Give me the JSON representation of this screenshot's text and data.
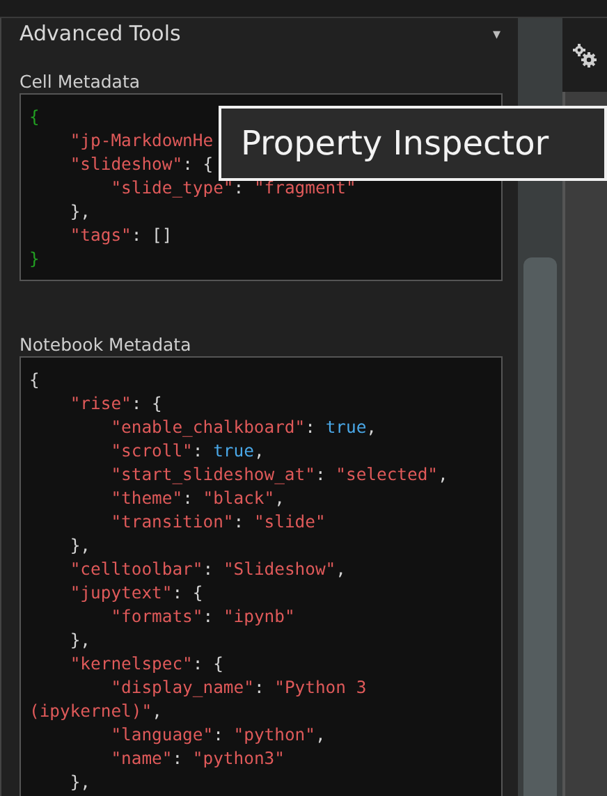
{
  "panel": {
    "title": "Advanced Tools",
    "collapse_icon": "▾"
  },
  "sections": [
    {
      "label": "Cell Metadata",
      "lines": [
        [
          {
            "kind": "brace",
            "text": "{"
          }
        ],
        [
          {
            "kind": "key",
            "text": "    \"jp-MarkdownHe"
          }
        ],
        [
          {
            "kind": "key",
            "text": "    \"slideshow\""
          },
          {
            "kind": "punct",
            "text": ": {"
          }
        ],
        [
          {
            "kind": "key",
            "text": "        \"slide_type\""
          },
          {
            "kind": "punct",
            "text": ": "
          },
          {
            "kind": "str",
            "text": "\"fragment\""
          }
        ],
        [
          {
            "kind": "punct",
            "text": "    },"
          }
        ],
        [
          {
            "kind": "key",
            "text": "    \"tags\""
          },
          {
            "kind": "punct",
            "text": ": []"
          }
        ],
        [
          {
            "kind": "brace",
            "text": "}"
          }
        ]
      ]
    },
    {
      "label": "Notebook Metadata",
      "lines": [
        [
          {
            "kind": "punct",
            "text": "{"
          }
        ],
        [
          {
            "kind": "key",
            "text": "    \"rise\""
          },
          {
            "kind": "punct",
            "text": ": {"
          }
        ],
        [
          {
            "kind": "key",
            "text": "        \"enable_chalkboard\""
          },
          {
            "kind": "punct",
            "text": ": "
          },
          {
            "kind": "bool",
            "text": "true"
          },
          {
            "kind": "punct",
            "text": ","
          }
        ],
        [
          {
            "kind": "key",
            "text": "        \"scroll\""
          },
          {
            "kind": "punct",
            "text": ": "
          },
          {
            "kind": "bool",
            "text": "true"
          },
          {
            "kind": "punct",
            "text": ","
          }
        ],
        [
          {
            "kind": "key",
            "text": "        \"start_slideshow_at\""
          },
          {
            "kind": "punct",
            "text": ": "
          },
          {
            "kind": "str",
            "text": "\"selected\""
          },
          {
            "kind": "punct",
            "text": ","
          }
        ],
        [
          {
            "kind": "key",
            "text": "        \"theme\""
          },
          {
            "kind": "punct",
            "text": ": "
          },
          {
            "kind": "str",
            "text": "\"black\""
          },
          {
            "kind": "punct",
            "text": ","
          }
        ],
        [
          {
            "kind": "key",
            "text": "        \"transition\""
          },
          {
            "kind": "punct",
            "text": ": "
          },
          {
            "kind": "str",
            "text": "\"slide\""
          }
        ],
        [
          {
            "kind": "punct",
            "text": "    },"
          }
        ],
        [
          {
            "kind": "key",
            "text": "    \"celltoolbar\""
          },
          {
            "kind": "punct",
            "text": ": "
          },
          {
            "kind": "str",
            "text": "\"Slideshow\""
          },
          {
            "kind": "punct",
            "text": ","
          }
        ],
        [
          {
            "kind": "key",
            "text": "    \"jupytext\""
          },
          {
            "kind": "punct",
            "text": ": {"
          }
        ],
        [
          {
            "kind": "key",
            "text": "        \"formats\""
          },
          {
            "kind": "punct",
            "text": ": "
          },
          {
            "kind": "str",
            "text": "\"ipynb\""
          }
        ],
        [
          {
            "kind": "punct",
            "text": "    },"
          }
        ],
        [
          {
            "kind": "key",
            "text": "    \"kernelspec\""
          },
          {
            "kind": "punct",
            "text": ": {"
          }
        ],
        [
          {
            "kind": "key",
            "text": "        \"display_name\""
          },
          {
            "kind": "punct",
            "text": ": "
          },
          {
            "kind": "str",
            "text": "\"Python 3"
          }
        ],
        [
          {
            "kind": "str",
            "text": "(ipykernel)\""
          },
          {
            "kind": "punct",
            "text": ","
          }
        ],
        [
          {
            "kind": "key",
            "text": "        \"language\""
          },
          {
            "kind": "punct",
            "text": ": "
          },
          {
            "kind": "str",
            "text": "\"python\""
          },
          {
            "kind": "punct",
            "text": ","
          }
        ],
        [
          {
            "kind": "key",
            "text": "        \"name\""
          },
          {
            "kind": "punct",
            "text": ": "
          },
          {
            "kind": "str",
            "text": "\"python3\""
          }
        ],
        [
          {
            "kind": "punct",
            "text": "    },"
          }
        ]
      ]
    }
  ],
  "tooltip": {
    "text": "Property Inspector"
  }
}
